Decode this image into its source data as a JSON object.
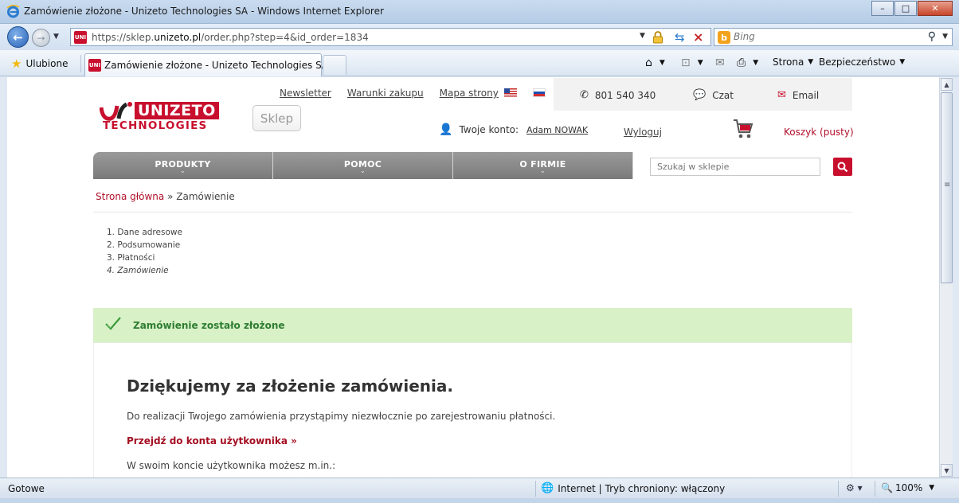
{
  "window": {
    "title": "Zamówienie złożone - Unizeto Technologies SA - Windows Internet Explorer",
    "minimize": "–",
    "maximize": "□",
    "close": "✕"
  },
  "addressbar": {
    "url_prefix": "https://sklep.",
    "url_host": "unizeto.pl",
    "url_rest": "/order.php?step=4&id_order=1834",
    "search_placeholder": "Bing"
  },
  "favbar": {
    "favorites_label": "Ulubione",
    "tab_title": "Zamówienie złożone - Unizeto Technologies SA",
    "page_menu": "Strona",
    "safety_menu": "Bezpieczeństwo"
  },
  "site": {
    "logo": {
      "line1": "UNIZETO",
      "line2": "TECHNOLOGIES"
    },
    "sklep_label": "Sklep",
    "toplinks": [
      "Newsletter",
      "Warunki zakupu",
      "Mapa strony"
    ],
    "contact": {
      "phone": "801 540 340",
      "chat": "Czat",
      "email": "Email"
    },
    "account": {
      "label": "Twoje konto:",
      "user": "Adam NOWAK",
      "logout": "Wyloguj"
    },
    "cart": "Koszyk (pusty)",
    "nav": [
      {
        "label": "PRODUKTY"
      },
      {
        "label": "POMOC"
      },
      {
        "label": "O FIRMIE"
      }
    ],
    "search_placeholder": "Szukaj w sklepie",
    "breadcrumb": {
      "home": "Strona główna",
      "separator": "»",
      "current": "Zamówienie"
    },
    "steps": [
      "1. Dane adresowe",
      "2. Podsumowanie",
      "3. Płatności",
      "4. Zamówienie"
    ],
    "success_message": "Zamówienie zostało złożone",
    "content": {
      "heading": "Dziękujemy za złożenie zamówienia.",
      "paragraph": "Do realizacji Twojego zamówienia przystąpimy niezwłocznie po zarejestrowaniu płatności.",
      "account_link": "Przejdź do konta użytkownika »",
      "paragraph2": "W swoim koncie użytkownika możesz m.in.:"
    }
  },
  "statusbar": {
    "state": "Gotowe",
    "zone": "Internet | Tryb chroniony: włączony",
    "zoom": "100%"
  },
  "colors": {
    "brand_red": "#c8102e",
    "success_bg": "#d9f1c7",
    "success_text": "#2e7d32",
    "nav_gray": "#8a8a8a"
  }
}
